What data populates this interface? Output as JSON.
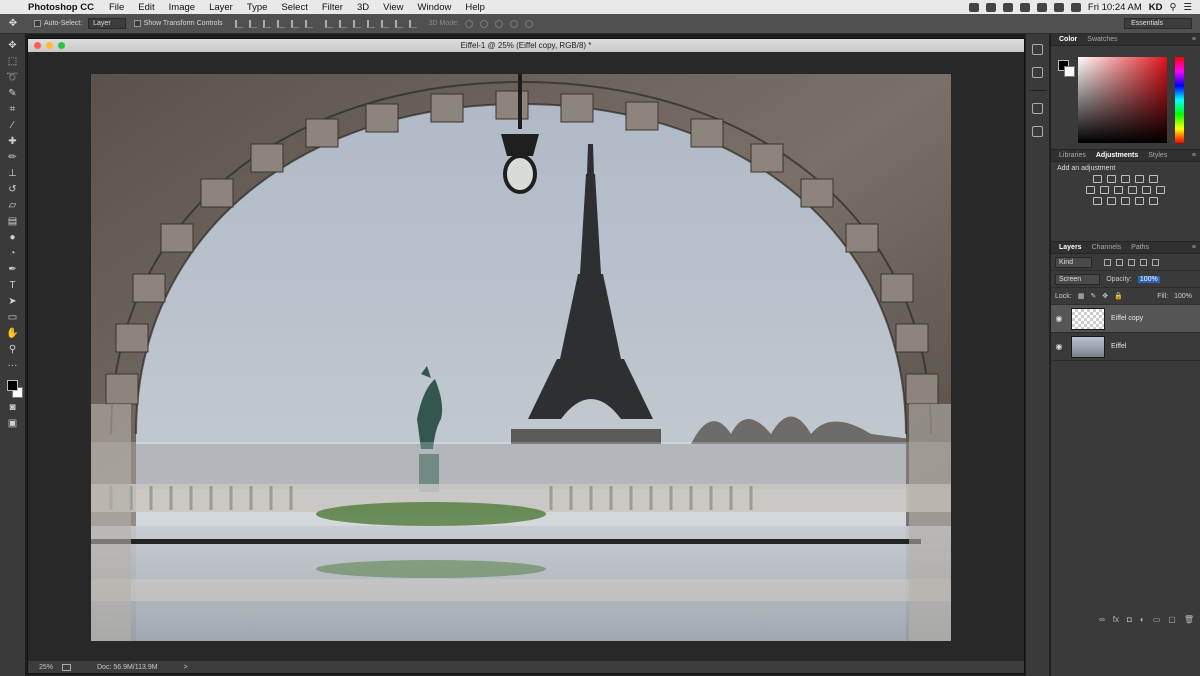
{
  "menubar": {
    "apple_glyph": "",
    "app_name": "Photoshop CC",
    "menus": [
      "File",
      "Edit",
      "Image",
      "Layer",
      "Type",
      "Select",
      "Filter",
      "3D",
      "View",
      "Window",
      "Help"
    ],
    "clock": "Fri 10:24 AM",
    "user": "KD"
  },
  "options_bar": {
    "auto_select_label": "Auto-Select:",
    "auto_select_value": "Layer",
    "transform_label": "Show Transform Controls",
    "mode_3d_label": "3D Mode:",
    "workspace": "Essentials"
  },
  "document": {
    "title": "Eiffel-1 @ 25% (Eiffel copy, RGB/8) *",
    "zoom": "25%",
    "doc_info": "Doc: 56.9M/113.9M",
    "status_arrow": ">"
  },
  "panels": {
    "color_tabs": [
      "Color",
      "Swatches"
    ],
    "color_active": "Color",
    "lib_tabs": [
      "Libraries",
      "Adjustments",
      "Styles"
    ],
    "lib_active": "Adjustments",
    "adjustment_title": "Add an adjustment",
    "layer_tabs": [
      "Layers",
      "Channels",
      "Paths"
    ],
    "layer_active": "Layers",
    "filter_kind": "Kind",
    "blend_mode": "Screen",
    "opacity_label": "Opacity:",
    "opacity_value": "100%",
    "lock_label": "Lock:",
    "fill_label": "Fill:",
    "fill_value": "100%",
    "layers": [
      {
        "name": "Eiffel copy",
        "selected": true,
        "thumb": "transparent"
      },
      {
        "name": "Eiffel",
        "selected": false,
        "thumb": "photo"
      }
    ],
    "menu_glyph": "≡"
  },
  "colors": {
    "foreground": "#000000",
    "background": "#ffffff",
    "picked_hue": "#e0131a"
  }
}
